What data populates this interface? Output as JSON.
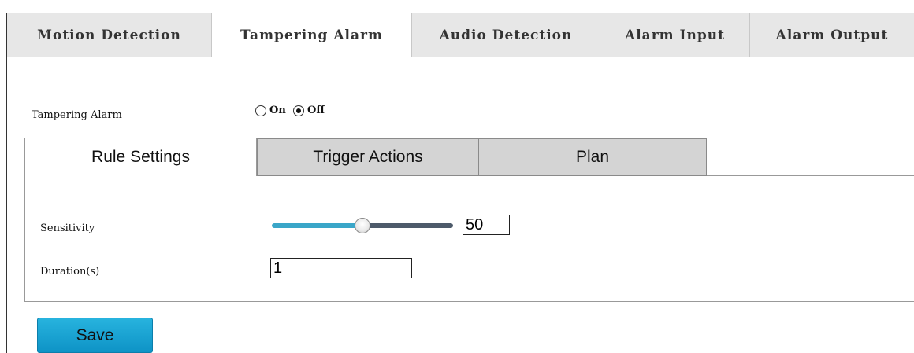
{
  "top_tabs": [
    {
      "label": "Motion Detection",
      "active": false
    },
    {
      "label": "Tampering Alarm",
      "active": true
    },
    {
      "label": "Audio Detection",
      "active": false
    },
    {
      "label": "Alarm Input",
      "active": false
    },
    {
      "label": "Alarm Output",
      "active": false
    }
  ],
  "tampering": {
    "label": "Tampering Alarm",
    "options": [
      {
        "label": "On",
        "checked": false
      },
      {
        "label": "Off",
        "checked": true
      }
    ]
  },
  "sub_tabs": [
    {
      "label": "Rule Settings",
      "active": true
    },
    {
      "label": "Trigger Actions",
      "active": false
    },
    {
      "label": "Plan",
      "active": false
    }
  ],
  "sensitivity": {
    "label": "Sensitivity",
    "value": "50",
    "fraction": 0.5
  },
  "duration": {
    "label": "Duration(s)",
    "value": "1"
  },
  "save_label": "Save",
  "colors": {
    "slider_filled": "#3aa6c8",
    "slider_empty": "#4d5a6a",
    "save_button": "#1aa3d4"
  }
}
